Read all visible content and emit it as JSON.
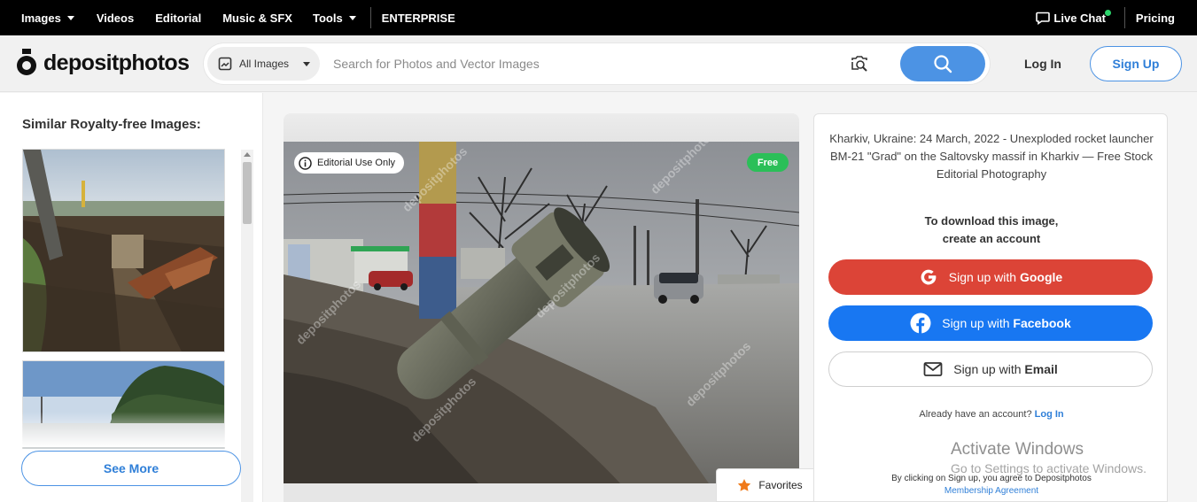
{
  "topnav": {
    "items": [
      {
        "label": "Images",
        "dropdown": true
      },
      {
        "label": "Videos",
        "dropdown": false
      },
      {
        "label": "Editorial",
        "dropdown": false
      },
      {
        "label": "Music & SFX",
        "dropdown": false
      },
      {
        "label": "Tools",
        "dropdown": true
      },
      {
        "label": "ENTERPRISE",
        "dropdown": false
      }
    ],
    "live_chat": "Live Chat",
    "pricing": "Pricing"
  },
  "header": {
    "logo_text": "depositphotos",
    "category": "All Images",
    "search_placeholder": "Search for Photos and Vector Images",
    "login": "Log In",
    "signup": "Sign Up"
  },
  "sidebar": {
    "title": "Similar Royalty-free Images:",
    "see_more": "See More"
  },
  "image": {
    "editorial_badge": "Editorial Use Only",
    "free_badge": "Free",
    "watermark": "depositphotos",
    "favorites": "Favorites"
  },
  "panel": {
    "description": "Kharkiv, Ukraine: 24 March, 2022 - Unexploded rocket launcher BM-21 \"Grad\" on the Saltovsky massif in Kharkiv — Free Stock Editorial Photography",
    "download_line1": "To download this image,",
    "download_line2": "create an account",
    "google_prefix": "Sign up with ",
    "google_name": "Google",
    "facebook_prefix": "Sign up with ",
    "facebook_name": "Facebook",
    "email_prefix": "Sign up with ",
    "email_name": "Email",
    "already_text": "Already have an account?",
    "login_link": "Log In",
    "terms_text": "By clicking on Sign up, you agree to Depositphotos",
    "terms_link": "Membership Agreement"
  },
  "watermark": {
    "line1": "Activate Windows",
    "line2": "Go to Settings to activate Windows."
  },
  "colors": {
    "brand_blue": "#4c93e4",
    "google_red": "#dc4437",
    "facebook_blue": "#1877f2",
    "free_green": "#2bbf58"
  }
}
